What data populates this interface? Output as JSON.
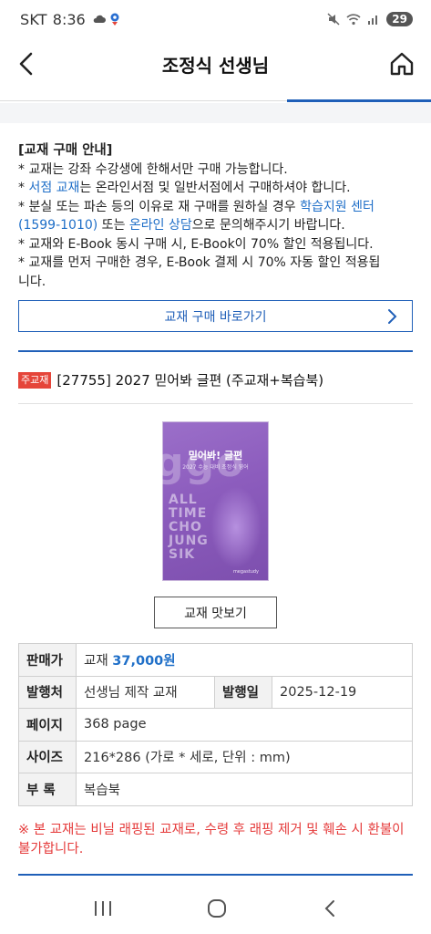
{
  "status_bar": {
    "carrier": "SKT",
    "time": "8:36",
    "battery": "29"
  },
  "header": {
    "title": "조정식 선생님"
  },
  "guide": {
    "title": "[교재 구매 안내]",
    "line1": "* 교재는 강좌 수강생에 한해서만 구매 가능합니다.",
    "line2_prefix": "* ",
    "line2_link": "서점 교재",
    "line2_suffix": "는 온라인서점 및 일반서점에서 구매하셔야 합니다.",
    "line3_prefix": "* 분실 또는 파손 등의 이유로 재 구매를 원하실 경우 ",
    "line3_link": "학습지원 센터",
    "line3b_link": "(1599-1010)",
    "line3b_mid": " 또는 ",
    "line3b_link2": "온라인 상담",
    "line3b_suffix": "으로 문의해주시기 바랍니다.",
    "line4": "* 교재와 E-Book 동시 구매 시, E-Book이 70% 할인 적용됩니다.",
    "line5a": "* 교재를 먼저 구매한 경우, E-Book 결제 시 70% 자동 할인 적용됩",
    "line5b": "니다."
  },
  "buy_button": {
    "label": "교재 구매 바로가기"
  },
  "product": {
    "tag": "주교재",
    "title": "[27755] 2027 믿어봐 글편 (주교재+복습북)",
    "cover_title": "믿어봐! 글편",
    "cover_subtitle": "2027 수능 대비 조정식 영어",
    "cover_big": "ALL\nTIME\nCHO\nJUNG\nSIK",
    "cover_publisher": "megastudy",
    "watermark": "ggo",
    "preview_label": "교재 맛보기"
  },
  "info_table": {
    "price_label": "판매가",
    "price_prefix": "교재 ",
    "price_value": "37,000원",
    "publisher_label": "발행처",
    "publisher_value": "선생님 제작 교재",
    "date_label": "발행일",
    "date_value": "2025-12-19",
    "pages_label": "페이지",
    "pages_value": "368 page",
    "size_label": "사이즈",
    "size_value": "216*286 (가로 * 세로, 단위 : mm)",
    "appendix_label": "부 록",
    "appendix_value": "복습북"
  },
  "warning": {
    "text": "※ 본 교재는 비닐 래핑된 교재로, 수령 후 래핑 제거 및 훼손 시 환불이 불가합니다."
  },
  "colors": {
    "accent": "#1f5fb8",
    "link": "#1f6fc8",
    "tag": "#e5453a",
    "warning": "#e53b3b"
  }
}
